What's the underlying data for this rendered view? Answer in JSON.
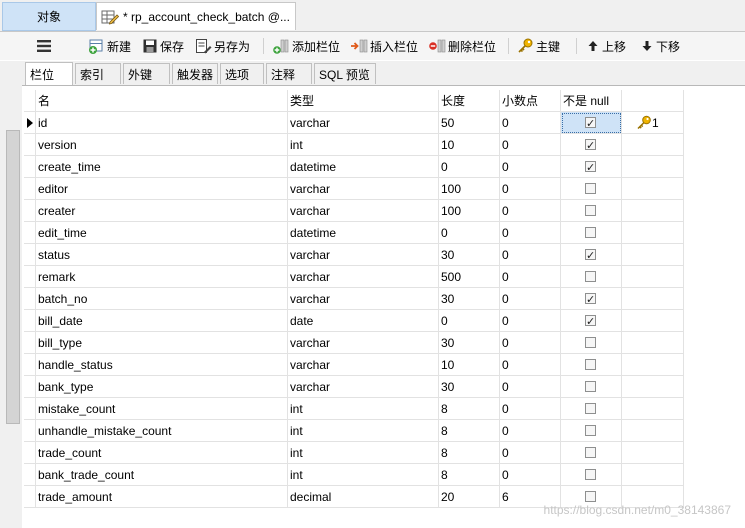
{
  "doc_tabs": {
    "object_tab": "对象",
    "document_tab": "* rp_account_check_batch @..."
  },
  "toolbar": {
    "new_label": "新建",
    "save_label": "保存",
    "save_as_label": "另存为",
    "add_field_label": "添加栏位",
    "insert_field_label": "插入栏位",
    "delete_field_label": "删除栏位",
    "primary_key_label": "主键",
    "move_up_label": "上移",
    "move_down_label": "下移"
  },
  "subtabs": [
    "栏位",
    "索引",
    "外键",
    "触发器",
    "选项",
    "注释",
    "SQL 预览"
  ],
  "table": {
    "headers": {
      "name": "名",
      "type": "类型",
      "length": "长度",
      "decimals": "小数点",
      "not_null": "不是 null",
      "key": ""
    },
    "rows": [
      {
        "name": "id",
        "type": "varchar",
        "length": "50",
        "decimals": "0",
        "not_null": true,
        "key": "1"
      },
      {
        "name": "version",
        "type": "int",
        "length": "10",
        "decimals": "0",
        "not_null": true,
        "key": ""
      },
      {
        "name": "create_time",
        "type": "datetime",
        "length": "0",
        "decimals": "0",
        "not_null": true,
        "key": ""
      },
      {
        "name": "editor",
        "type": "varchar",
        "length": "100",
        "decimals": "0",
        "not_null": false,
        "key": ""
      },
      {
        "name": "creater",
        "type": "varchar",
        "length": "100",
        "decimals": "0",
        "not_null": false,
        "key": ""
      },
      {
        "name": "edit_time",
        "type": "datetime",
        "length": "0",
        "decimals": "0",
        "not_null": false,
        "key": ""
      },
      {
        "name": "status",
        "type": "varchar",
        "length": "30",
        "decimals": "0",
        "not_null": true,
        "key": ""
      },
      {
        "name": "remark",
        "type": "varchar",
        "length": "500",
        "decimals": "0",
        "not_null": false,
        "key": ""
      },
      {
        "name": "batch_no",
        "type": "varchar",
        "length": "30",
        "decimals": "0",
        "not_null": true,
        "key": ""
      },
      {
        "name": "bill_date",
        "type": "date",
        "length": "0",
        "decimals": "0",
        "not_null": true,
        "key": ""
      },
      {
        "name": "bill_type",
        "type": "varchar",
        "length": "30",
        "decimals": "0",
        "not_null": false,
        "key": ""
      },
      {
        "name": "handle_status",
        "type": "varchar",
        "length": "10",
        "decimals": "0",
        "not_null": false,
        "key": ""
      },
      {
        "name": "bank_type",
        "type": "varchar",
        "length": "30",
        "decimals": "0",
        "not_null": false,
        "key": ""
      },
      {
        "name": "mistake_count",
        "type": "int",
        "length": "8",
        "decimals": "0",
        "not_null": false,
        "key": ""
      },
      {
        "name": "unhandle_mistake_count",
        "type": "int",
        "length": "8",
        "decimals": "0",
        "not_null": false,
        "key": ""
      },
      {
        "name": "trade_count",
        "type": "int",
        "length": "8",
        "decimals": "0",
        "not_null": false,
        "key": ""
      },
      {
        "name": "bank_trade_count",
        "type": "int",
        "length": "8",
        "decimals": "0",
        "not_null": false,
        "key": ""
      },
      {
        "name": "trade_amount",
        "type": "decimal",
        "length": "20",
        "decimals": "6",
        "not_null": false,
        "key": ""
      }
    ]
  },
  "watermark": "https://blog.csdn.net/m0_38143867",
  "colors": {
    "selection": "#cfe3f7",
    "key_icon": "#e0a400"
  }
}
